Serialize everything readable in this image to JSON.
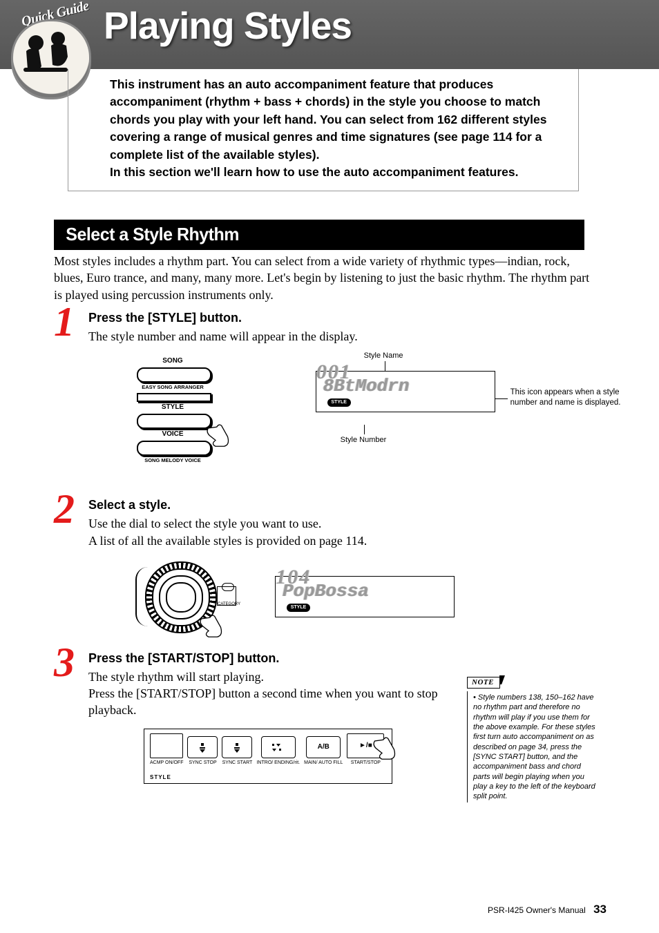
{
  "guide_badge": "Quick Guide",
  "title": "Playing Styles",
  "intro": "This instrument has an auto accompaniment feature that produces accompaniment (rhythm + bass + chords) in the style you choose to match chords you play with your left hand. You can select from 162 different styles covering a range of musical genres and time signatures (see page 114 for a complete list of the available styles).\nIn this section we'll learn how to use the auto accompaniment features.",
  "section_heading": "Select a Style Rhythm",
  "section_intro": "Most styles includes a rhythm part. You can select from a wide variety of rhythmic types—indian, rock, blues, Euro trance, and many, many more. Let's begin by listening to just the basic rhythm. The rhythm part is played using percussion instruments only.",
  "steps": [
    {
      "num": "1",
      "head": "Press the [STYLE] button.",
      "text": "The style number and name will appear in the display."
    },
    {
      "num": "2",
      "head": "Select a style.",
      "text": "Use the dial to select the style you want to use.\nA list of all the available styles is provided on page 114."
    },
    {
      "num": "3",
      "head": "Press the [START/STOP] button.",
      "text": "The style rhythm will start playing.\nPress the [START/STOP] button a second time when you want to stop playback."
    }
  ],
  "panel_buttons": {
    "song": "SONG",
    "easy": "EASY SONG ARRANGER",
    "style": "STYLE",
    "voice": "VOICE",
    "melody": "SONG MELODY VOICE"
  },
  "lcd1": {
    "name": "8BtModrn",
    "num": "001",
    "tag": "STYLE"
  },
  "lcd2": {
    "name": "PopBossa",
    "num": "104",
    "tag": "STYLE"
  },
  "callouts": {
    "style_name": "Style Name",
    "style_number": "Style Number",
    "icon_note": "This icon appears when a style number and name is displayed."
  },
  "dial": {
    "category": "CATEGORY"
  },
  "style_controls": {
    "acmp": "ACMP ON/OFF",
    "sync_stop": "SYNC STOP",
    "sync_start": "SYNC START",
    "intro": "INTRO/ ENDING/rit.",
    "main": "MAIN/ AUTO FILL",
    "ab": "A/B",
    "start_stop": "START/STOP",
    "section": "STYLE",
    "play_glyph": "►/■"
  },
  "note": {
    "label": "NOTE",
    "text": "Style numbers 138, 150–162 have no rhythm part and therefore no rhythm will play if you use them for the above example. For these styles first turn auto accompaniment on as described on page 34, press the [SYNC START] button, and the accompaniment bass and chord parts will begin playing when you play a key to the left of the keyboard split point."
  },
  "footer": {
    "manual": "PSR-I425  Owner's Manual",
    "page": "33"
  }
}
